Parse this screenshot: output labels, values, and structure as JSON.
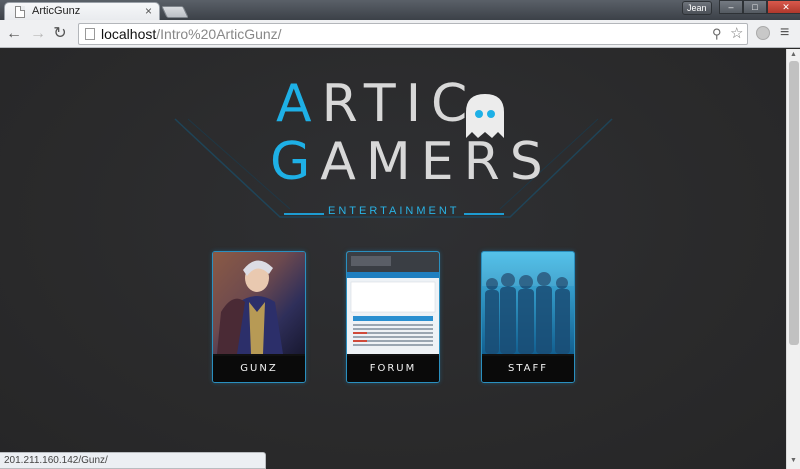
{
  "browser": {
    "tab_title": "ArticGunz",
    "tab_close": "×",
    "user_name": "Jean",
    "window_controls": [
      "–",
      "□",
      "✕"
    ],
    "url_host": "localhost",
    "url_path": "/Intro%20ArticGunz/",
    "nav": {
      "back": "←",
      "forward": "→",
      "reload": "↻"
    },
    "status_url": "201.211.160.142/Gunz/"
  },
  "logo": {
    "line1_accent": "A",
    "line1_rest": "RTIC",
    "line2_accent": "G",
    "line2_rest": "AMERS",
    "subtitle": "ENTERTAINMENT"
  },
  "cards": [
    {
      "label": "GUNZ",
      "icon": "character-art"
    },
    {
      "label": "FORUM",
      "icon": "forum-screenshot"
    },
    {
      "label": "STAFF",
      "icon": "staff-silhouettes"
    }
  ],
  "colors": {
    "accent": "#1eb0e6",
    "background": "#2a2a2a"
  }
}
